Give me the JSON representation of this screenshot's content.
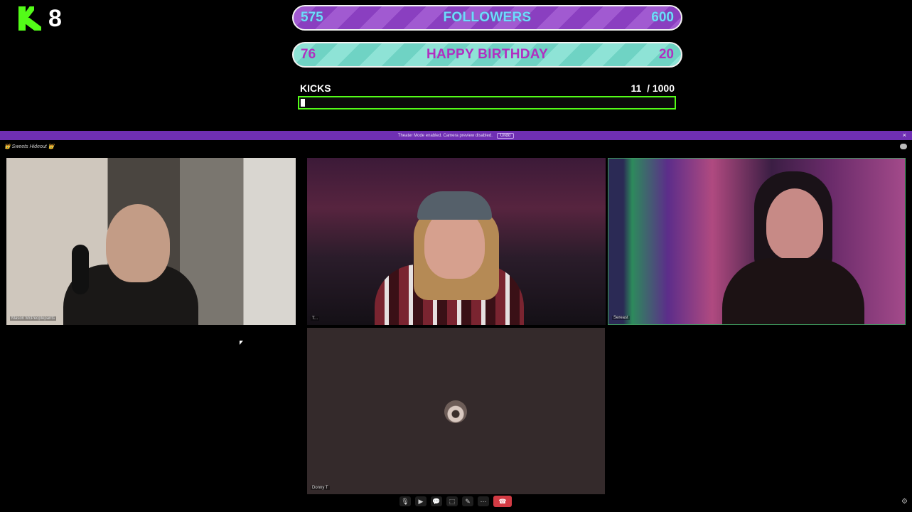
{
  "overlay": {
    "logo_number": "8",
    "followers_goal": {
      "current": "575",
      "label": "FOLLOWERS",
      "target": "600"
    },
    "birthday_goal": {
      "current": "76",
      "label": "HAPPY BIRTHDAY",
      "target": "20"
    },
    "kicks": {
      "label": "KICKS",
      "current": "11",
      "target": "/ 1000",
      "progress": 0.011
    }
  },
  "call": {
    "banner_text": "Theater Mode enabled. Camera preview disabled.",
    "banner_button": "Undo",
    "title": "👑 Sweets Hideout 👑",
    "participants": [
      {
        "name": "Mason McPeoplepants"
      },
      {
        "name": "T..."
      },
      {
        "name": "Sereast"
      },
      {
        "name": "Donny T"
      }
    ],
    "toolbar": {
      "mic": "🎙",
      "cam": "▶",
      "chat": "💬",
      "share": "⬚",
      "effects": "✎",
      "more": "⋯",
      "leave": "☎"
    },
    "colors": {
      "kick_green": "#53fc18",
      "banner_purple": "#6f2fb3",
      "leave_red": "#d23b44"
    }
  }
}
